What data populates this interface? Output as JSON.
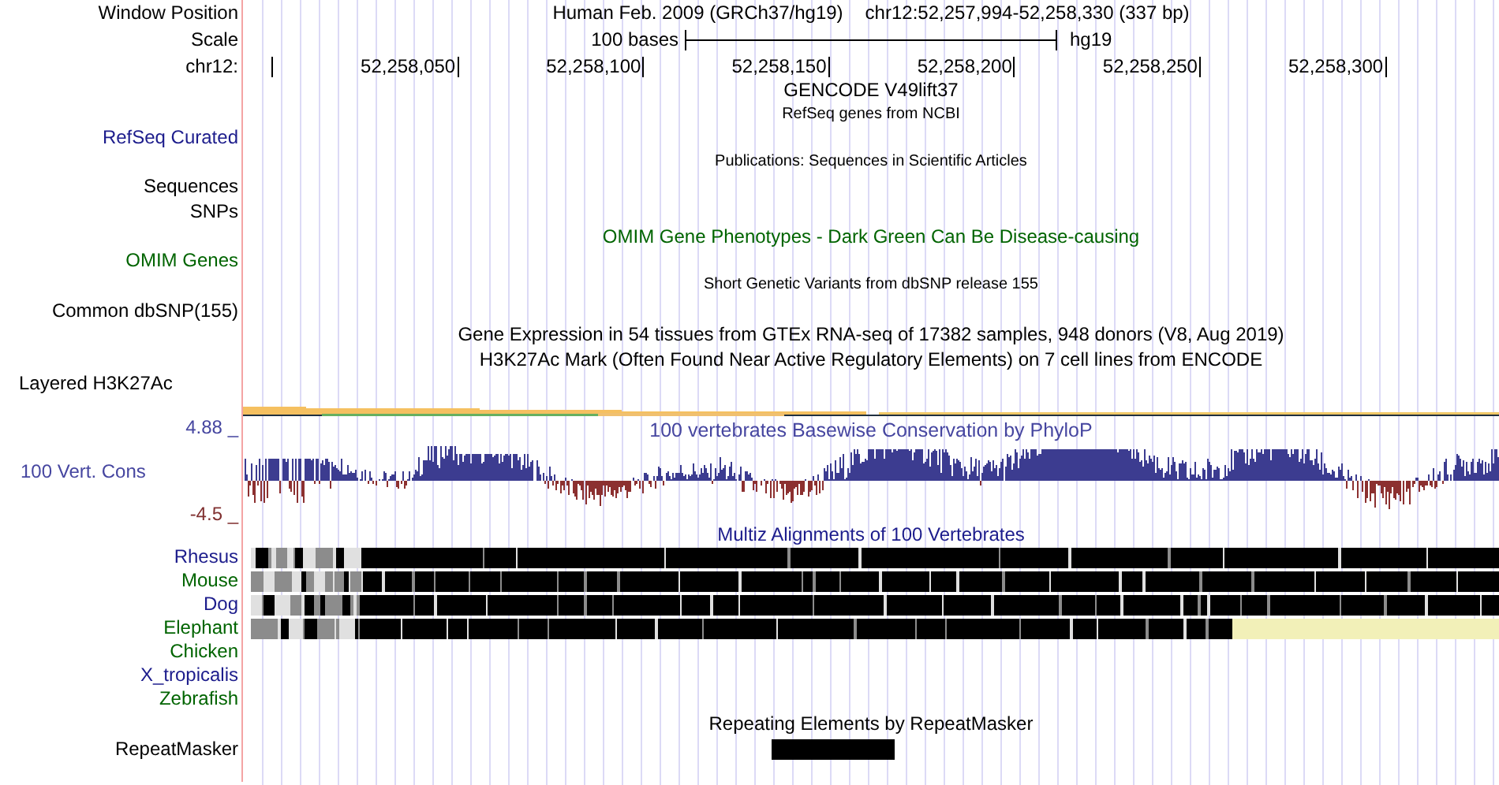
{
  "header": {
    "label": "Window Position",
    "assembly": "Human Feb. 2009 (GRCh37/hg19)",
    "position": "chr12:52,257,994-52,258,330 (337 bp)"
  },
  "scale": {
    "label": "Scale",
    "length": "100 bases",
    "assembly": "hg19"
  },
  "ruler": {
    "label": "chr12:",
    "ticks": [
      "52,258,050",
      "52,258,100",
      "52,258,150",
      "52,258,200",
      "52,258,250",
      "52,258,300"
    ]
  },
  "rows": [
    {
      "kind": "title",
      "text": "GENCODE V49lift37",
      "color": "#000000"
    },
    {
      "kind": "note",
      "text": "RefSeq genes from NCBI",
      "color": "#000000"
    },
    {
      "kind": "label",
      "text": "RefSeq Curated",
      "color": "#1c1c8c"
    },
    {
      "kind": "note",
      "text": "Publications: Sequences in Scientific Articles",
      "color": "#000000"
    },
    {
      "kind": "label",
      "text": "Sequences",
      "color": "#000000"
    },
    {
      "kind": "label",
      "text": "SNPs",
      "color": "#000000"
    },
    {
      "kind": "title",
      "text": "OMIM Gene Phenotypes - Dark Green Can Be Disease-causing",
      "color": "#006400"
    },
    {
      "kind": "label",
      "text": "OMIM Genes",
      "color": "#006400"
    },
    {
      "kind": "note",
      "text": "Short Genetic Variants from dbSNP release 155",
      "color": "#000000"
    },
    {
      "kind": "label",
      "text": "Common dbSNP(155)",
      "color": "#000000"
    },
    {
      "kind": "title",
      "text": "Gene Expression in 54 tissues from GTEx RNA-seq of 17382 samples, 948 donors (V8, Aug 2019)",
      "color": "#000000"
    },
    {
      "kind": "title",
      "text": "H3K27Ac Mark (Often Found Near Active Regulatory Elements) on 7 cell lines from ENCODE",
      "color": "#000000"
    }
  ],
  "h3k27ac": {
    "label": "Layered H3K27Ac"
  },
  "conservation": {
    "title": "100 vertebrates Basewise Conservation by PhyloP",
    "label": "100 Vert. Cons",
    "max": "4.88 _",
    "min": "-4.5 _"
  },
  "multiz": {
    "title": "Multiz Alignments of 100 Vertebrates",
    "species": [
      {
        "name": "Rhesus",
        "color": "#1c1c8c",
        "kind": "full"
      },
      {
        "name": "Mouse",
        "color": "#006400",
        "kind": "full"
      },
      {
        "name": "Dog",
        "color": "#1c1c8c",
        "kind": "full"
      },
      {
        "name": "Elephant",
        "color": "#006400",
        "kind": "partial"
      },
      {
        "name": "Chicken",
        "color": "#006400",
        "kind": "none"
      },
      {
        "name": "X_tropicalis",
        "color": "#1c1c8c",
        "kind": "none"
      },
      {
        "name": "Zebrafish",
        "color": "#006400",
        "kind": "none"
      }
    ]
  },
  "repeats": {
    "title": "Repeating Elements by RepeatMasker",
    "label": "RepeatMasker"
  }
}
